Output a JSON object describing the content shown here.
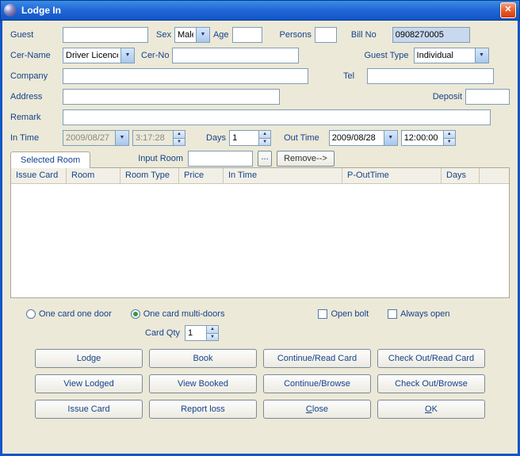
{
  "window": {
    "title": "Lodge In"
  },
  "labels": {
    "guest": "Guest",
    "sex": "Sex",
    "age": "Age",
    "persons": "Persons",
    "billno": "Bill No",
    "cername": "Cer-Name",
    "cerno": "Cer-No",
    "guesttype": "Guest Type",
    "company": "Company",
    "tel": "Tel",
    "address": "Address",
    "deposit": "Deposit",
    "remark": "Remark",
    "intime": "In Time",
    "days": "Days",
    "outtime": "Out Time",
    "cardqty": "Card Qty",
    "inputroom": "Input Room"
  },
  "fields": {
    "guest": "",
    "sex": "Male",
    "age": "",
    "persons": "",
    "billno": "0908270005",
    "cername": "Driver Licence",
    "cerno": "",
    "guesttype": "Individual",
    "company": "",
    "tel": "",
    "address": "",
    "deposit": "",
    "remark": "",
    "indate": "2009/08/27",
    "intime": "3:17:28",
    "days": "1",
    "outdate": "2009/08/28",
    "outtime": "12:00:00",
    "cardqty": "1",
    "inputroom": ""
  },
  "tab": {
    "selected": "Selected Room"
  },
  "table": {
    "columns": [
      "Issue Card",
      "Room",
      "Room Type",
      "Price",
      "In Time",
      "P-OutTime",
      "Days"
    ]
  },
  "inputroom": {
    "remove": "Remove-->"
  },
  "options": {
    "onedoor": "One card one door",
    "multidoor": "One card multi-doors",
    "openbolt": "Open bolt",
    "alwaysopen": "Always open",
    "selected_radio": "multi"
  },
  "buttons": {
    "lodge": "Lodge",
    "book": "Book",
    "contread": "Continue/Read Card",
    "checkoutread": "Check Out/Read Card",
    "viewlodged": "View Lodged",
    "viewbooked": "View Booked",
    "contbrowse": "Continue/Browse",
    "checkoutbrowse": "Check Out/Browse",
    "issuecard": "Issue Card",
    "reportloss": "Report loss",
    "close": "Close",
    "ok": "OK"
  }
}
